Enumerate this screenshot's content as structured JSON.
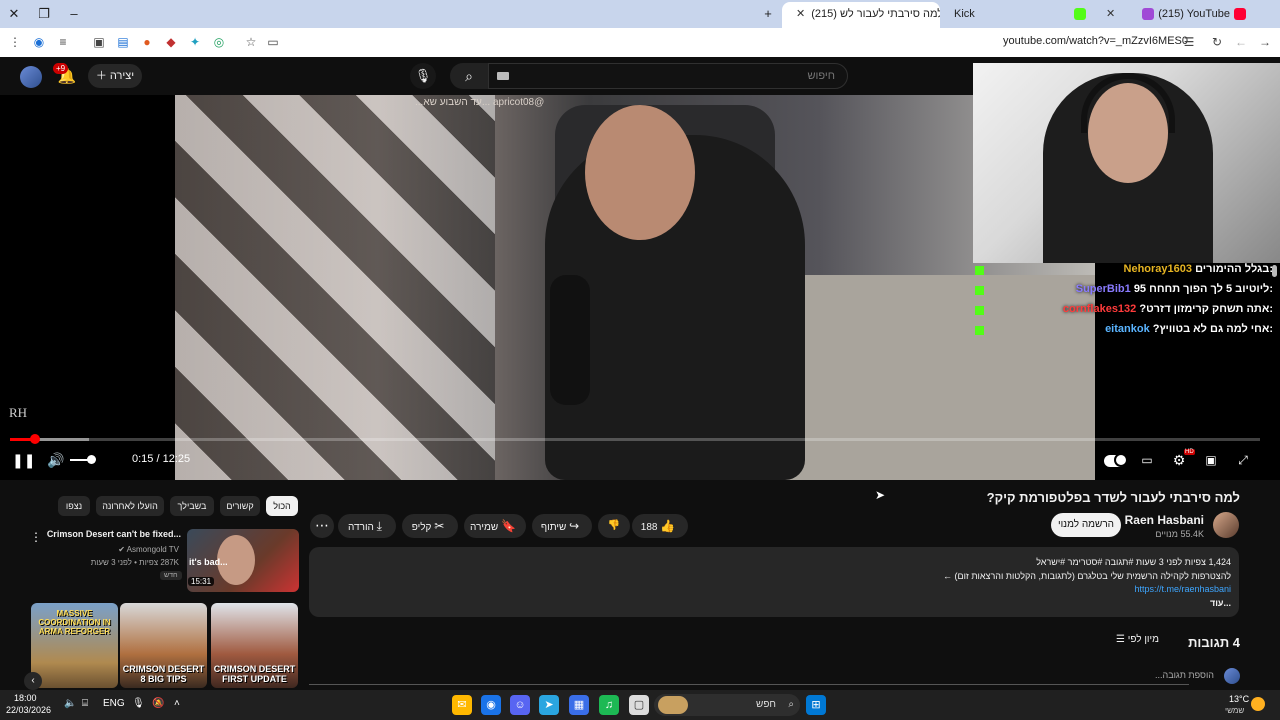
{
  "browser": {
    "tabs": [
      {
        "label": "(215) YouTube",
        "favicon": "youtube-icon"
      },
      {
        "label": "Kick",
        "favicon": "kick-icon"
      },
      {
        "label": "(215) למה סירבתי לעבור לש...",
        "favicon": "youtube-icon"
      }
    ],
    "url": "youtube.com/watch?v=_mZzvI6MES0"
  },
  "header": {
    "notifications_badge": "+9",
    "create_label": "יצירה",
    "search_placeholder": "חיפוש"
  },
  "player": {
    "overlay_text": "@apricot08   ...עד השבוע שא...",
    "watermark": "RH",
    "time": "0:15 / 12:25",
    "progress_fraction": 0.0201,
    "buffer_fraction": 0.063,
    "hd_badge": "HD"
  },
  "kick_chat": [
    {
      "user": "Nehoray1603",
      "message": ":בגלל ההימורים",
      "color": "#e6b422"
    },
    {
      "user": "SuperBib1",
      "message": ":ליוטיוב 5 לך הפוך תחחח 95",
      "color": "#8a7bff"
    },
    {
      "user": "cornflakes132",
      "message": ":אתה תשחק קרימזון דזרט?",
      "color": "#ff3b3b"
    },
    {
      "user": "eitankok",
      "message": ":אחי למה גם לא בטוויץ?",
      "color": "#5ab4ff"
    }
  ],
  "video": {
    "title": "למה סירבתי לעבור לשדר בפלטפורמת קיק?",
    "channel_name": "Raen Hasbani",
    "channel_subs": "55.4K מנויים",
    "subscribe_label": "הרשמה למנוי",
    "like_count": "188",
    "share_label": "שיתוף",
    "save_label": "שמירה",
    "clip_label": "קליפ",
    "download_label": "הורדה"
  },
  "description": {
    "views": "1,424 צפיות  לפני 3 שעות  #תגובה #סטרימר #ישראל",
    "line2": "להצטרפות לקהילה הרשמית שלי בטלגרם (לתגובות, הקלטות והרצאות זום) ←",
    "link": "https://t.me/raenhasbani",
    "more": "...עוד"
  },
  "comments": {
    "count": "4 תגובות",
    "sort_label": "מיון לפי",
    "add_placeholder": "הוספת תגובה..."
  },
  "chips": [
    "הכול",
    "קשורים",
    "בשבילך",
    "הועלו לאחרונה",
    "נצפו"
  ],
  "related": {
    "title": "Crimson Desert can't be fixed...",
    "channel": "Asmongold TV",
    "meta": "287K צפיות • לפני 3 שעות",
    "badge_new": "חדש",
    "duration": "15:31",
    "thumb_caption": "it's bad..."
  },
  "shelf": [
    {
      "cap_top": "MASSIVE COORDINATION IN ARMA REFORGER",
      "cap_bottom": ""
    },
    {
      "cap_top": "",
      "cap_bottom": "CRIMSON DESERT 8 BIG TIPS"
    },
    {
      "cap_top": "",
      "cap_bottom": "CRIMSON DESERT FIRST UPDATE"
    }
  ],
  "taskbar": {
    "time": "18:00",
    "date": "22/03/2026",
    "lang": "ENG",
    "search_label": "חפש",
    "weather_temp": "13°C",
    "weather_desc": "שמשי"
  }
}
